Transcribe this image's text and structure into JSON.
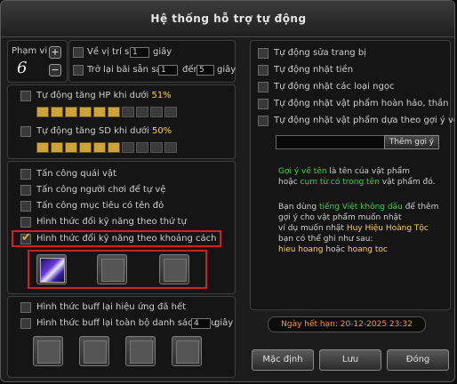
{
  "window": {
    "title": "Hệ thống hỗ trợ tự động",
    "close": "×"
  },
  "range": {
    "label": "Phạm vi",
    "value": "6",
    "plus": "+",
    "minus": "−"
  },
  "top": {
    "return_label": "Về vị trí sau",
    "return_value": "1",
    "return_unit": "giây",
    "back_label": "Trở lại bãi sẵn sau",
    "back_from": "1",
    "back_to_label": "đến",
    "back_to": "5",
    "back_unit": "giây"
  },
  "hp": {
    "label": "Tự động tăng HP khi dưới",
    "percent": "51%",
    "filled": 6,
    "total": 10
  },
  "sd": {
    "label": "Tự động tăng SD khi dưới",
    "percent": "50%",
    "filled": 6,
    "total": 10
  },
  "attack": {
    "items": [
      {
        "label": "Tấn công quái vật",
        "checked": false
      },
      {
        "label": "Tấn công người chơi để tự vệ",
        "checked": false
      },
      {
        "label": "Tấn công mục tiêu có tên đỏ",
        "checked": false
      },
      {
        "label": "Hình thức đổi kỹ năng theo thứ tự",
        "checked": false
      },
      {
        "label": "Hình thức đổi kỹ năng theo khoảng cách",
        "checked": true
      }
    ],
    "check_mark": "✔"
  },
  "buff": {
    "expire_label": "Hình thức buff lại hiệu ứng đã hết",
    "list_label": "Hình thức buff lại toàn bộ danh sách sau",
    "list_value": "4",
    "list_unit": "giây"
  },
  "right": {
    "items": [
      {
        "label": "Tự động sửa trang bị"
      },
      {
        "label": "Tự động nhặt tiền"
      },
      {
        "label": "Tự động nhặt các loại ngọc"
      },
      {
        "label": "Tự động nhặt vật phẩm hoàn hảo, thần"
      },
      {
        "label": "Tự động nhặt vật phẩm dựa theo gợi ý về tên"
      }
    ],
    "add_hint_button": "Thêm gợi ý"
  },
  "info": {
    "p1_a": "Gợi ý về tên",
    "p1_b": " là tên của vật phẩm",
    "p1_c": "hoặc ",
    "p1_d": "cụm từ có trong tên",
    "p1_e": " vật phẩm đó.",
    "p2_a": "Bạn dùng ",
    "p2_b": "tiếng Việt không dấu",
    "p2_c": " để thêm",
    "p2_d": "gợi ý cho vật phẩm muốn nhặt",
    "p2_e": "ví dụ muốn nhặt ",
    "p2_f": "Huy Hiệu Hoàng Tộc",
    "p2_g": "bạn có thể ghi như sau:",
    "p2_h": "hieu hoang",
    "p2_i": " hoặc ",
    "p2_j": "hoang toc"
  },
  "expiry": {
    "label": "Ngày hết hạn: 20-12-2025  23:32"
  },
  "buttons": {
    "default": "Mặc định",
    "save": "Lưu",
    "close": "Đóng"
  },
  "colors": {
    "highlight_red": "#d31f1f",
    "bar_gold": "#cda43a",
    "info_green": "#3bd13b",
    "info_yellow": "#ffd23c",
    "expiry_orange": "#ff9a1a"
  }
}
